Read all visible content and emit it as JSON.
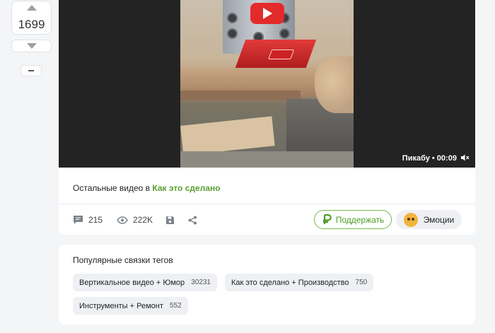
{
  "vote": {
    "count": "1699"
  },
  "video": {
    "source_label": "Пикабу • 00:09"
  },
  "post": {
    "other_videos_prefix": "Остальные видео в",
    "other_videos_link": "Как это сделано",
    "actions": {
      "comments": "215",
      "views": "222K"
    },
    "support_label": "Поддержать",
    "emotions_label": "Эмоции"
  },
  "tags": {
    "title": "Популярные связки тегов",
    "items": [
      {
        "label": "Вертикальное видео + Юмор",
        "count": "30231"
      },
      {
        "label": "Как это сделано + Производство",
        "count": "750"
      },
      {
        "label": "Инструменты + Ремонт",
        "count": "552"
      }
    ]
  },
  "colors": {
    "accent_green": "#5a9e2f",
    "play_red": "#e42b2b",
    "page_bg": "#f4f5f7"
  },
  "icons": [
    "chevron-up-icon",
    "chevron-down-icon",
    "collapse-icon",
    "play-icon",
    "mute-icon",
    "comment-icon",
    "eye-icon",
    "save-icon",
    "share-icon",
    "ruble-icon",
    "emoji-icon"
  ]
}
